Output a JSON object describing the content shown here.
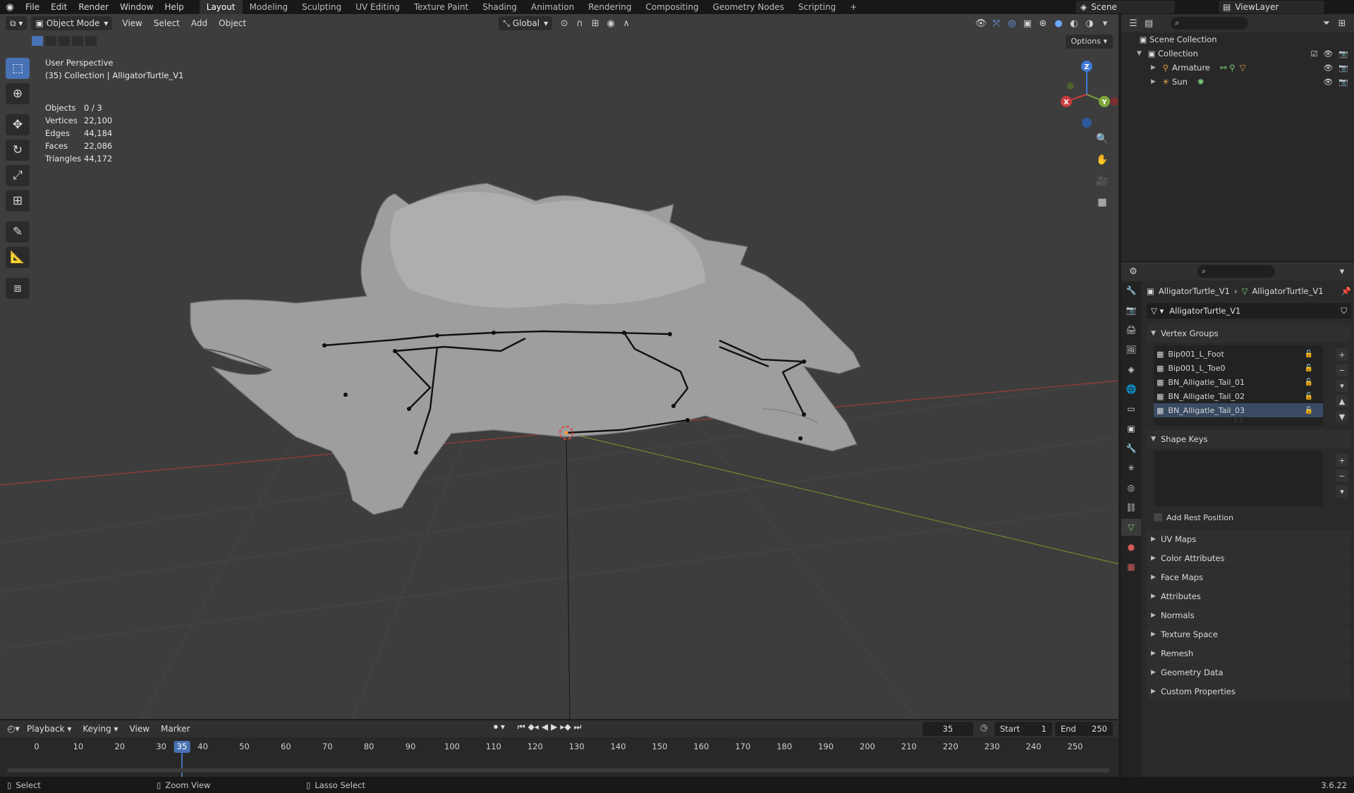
{
  "topbar": {
    "menus": [
      "File",
      "Edit",
      "Render",
      "Window",
      "Help"
    ],
    "workspaces": [
      "Layout",
      "Modeling",
      "Sculpting",
      "UV Editing",
      "Texture Paint",
      "Shading",
      "Animation",
      "Rendering",
      "Compositing",
      "Geometry Nodes",
      "Scripting"
    ],
    "active_workspace": "Layout",
    "scene": "Scene",
    "view_layer": "ViewLayer"
  },
  "viewport": {
    "mode": "Object Mode",
    "menus": [
      "View",
      "Select",
      "Add",
      "Object"
    ],
    "transform_orientation": "Global",
    "options_label": "Options",
    "perspective": "User Perspective",
    "collection_info": "(35) Collection | AlligatorTurtle_V1",
    "stats": [
      {
        "label": "Objects",
        "value": "0 / 3"
      },
      {
        "label": "Vertices",
        "value": "22,100"
      },
      {
        "label": "Edges",
        "value": "44,184"
      },
      {
        "label": "Faces",
        "value": "22,086"
      },
      {
        "label": "Triangles",
        "value": "44,172"
      }
    ],
    "gizmo_axes": {
      "x": "X",
      "y": "Y",
      "z": "Z"
    }
  },
  "outliner": {
    "root": "Scene Collection",
    "collection": "Collection",
    "objects": [
      "Armature",
      "Sun"
    ]
  },
  "properties": {
    "breadcrumb_object": "AlligatorTurtle_V1",
    "breadcrumb_data": "AlligatorTurtle_V1",
    "datablock_name": "AlligatorTurtle_V1",
    "vertex_groups_title": "Vertex Groups",
    "vertex_groups": [
      "Bip001_L_Foot",
      "Bip001_L_Toe0",
      "BN_Alligatle_Tail_01",
      "BN_Alligatle_Tail_02",
      "BN_Alligatle_Tail_03"
    ],
    "selected_vertex_group": "BN_Alligatle_Tail_03",
    "shape_keys_title": "Shape Keys",
    "add_rest_position": "Add Rest Position",
    "panels": [
      "UV Maps",
      "Color Attributes",
      "Face Maps",
      "Attributes",
      "Normals",
      "Texture Space",
      "Remesh",
      "Geometry Data",
      "Custom Properties"
    ]
  },
  "timeline": {
    "menus": [
      "Playback",
      "Keying",
      "View",
      "Marker"
    ],
    "current_frame": "35",
    "start_label": "Start",
    "start_value": "1",
    "end_label": "End",
    "end_value": "250",
    "ticks": [
      "0",
      "10",
      "20",
      "30",
      "40",
      "50",
      "60",
      "70",
      "80",
      "90",
      "100",
      "110",
      "120",
      "130",
      "140",
      "150",
      "160",
      "170",
      "180",
      "190",
      "200",
      "210",
      "220",
      "230",
      "240",
      "250"
    ]
  },
  "statusbar": {
    "select": "Select",
    "zoom": "Zoom View",
    "lasso": "Lasso Select",
    "version": "3.6.22"
  },
  "colors": {
    "accent": "#4772b3",
    "x_axis": "#c83c3c",
    "y_axis": "#7ea53a",
    "z_axis": "#3e7ad6"
  }
}
